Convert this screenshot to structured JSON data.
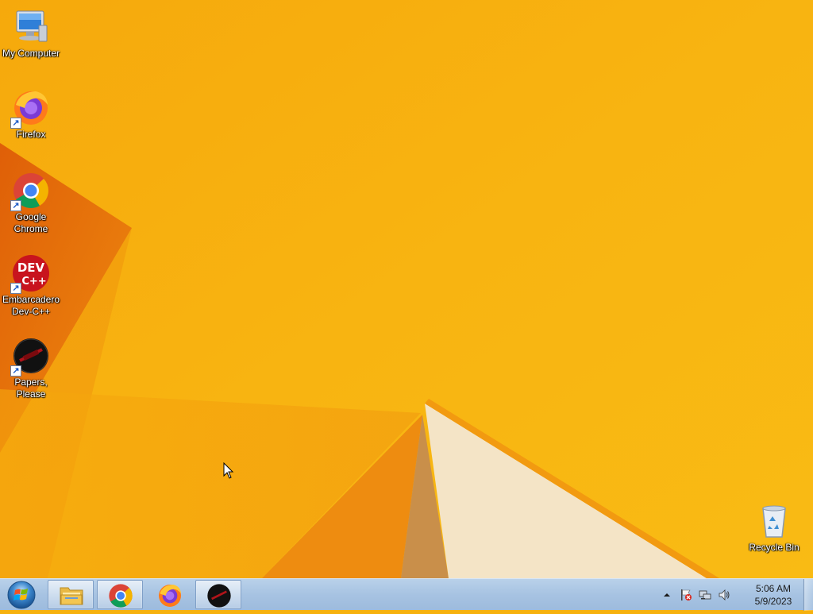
{
  "desktop": {
    "icons": [
      {
        "label": "My Computer",
        "icon": "computer-icon"
      },
      {
        "label": "Firefox",
        "icon": "firefox-icon"
      },
      {
        "label": "Google Chrome",
        "icon": "chrome-icon"
      },
      {
        "label": "Embarcadero Dev-C++",
        "icon": "devcpp-icon",
        "glyph_top": "DEV",
        "glyph_bottom": "C++"
      },
      {
        "label": "Papers, Please",
        "icon": "papers-please-icon"
      },
      {
        "label": "Recycle Bin",
        "icon": "recycle-bin-icon"
      }
    ]
  },
  "taskbar": {
    "pinned": [
      {
        "name": "file-explorer",
        "icon": "folder-icon"
      },
      {
        "name": "google-chrome",
        "icon": "chrome-icon",
        "active": true
      },
      {
        "name": "firefox",
        "icon": "firefox-icon"
      },
      {
        "name": "papers-please",
        "icon": "papers-please-icon",
        "active": true
      }
    ],
    "tray": {
      "icons": [
        "chevron-up-icon",
        "action-center-flag-icon",
        "network-icon",
        "volume-icon"
      ],
      "time": "5:06 AM",
      "date": "5/9/2023"
    }
  },
  "colors": {
    "wallpaper_base": "#f6b10e",
    "wallpaper_dark": "#e0660a",
    "wallpaper_light": "#f3e2c4",
    "taskbar": "#a9c4e3"
  }
}
